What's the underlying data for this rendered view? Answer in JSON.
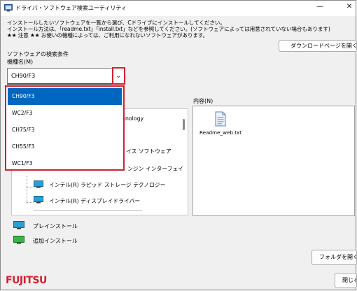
{
  "window": {
    "title": "ドライバ・ソフトウェア検索ユーティリティ",
    "minimize": "—",
    "close": "✕"
  },
  "intro": {
    "line1": "インストールしたいソフトウェアを一覧から選び、Cドライブにインストールしてください。",
    "line2": "インストール方法は、「readme.txt」「install.txt」などを参照してください。(ソフトウェアによっては用意されていない場合もあります)",
    "line3": "★★ 注意 ★★ お使いの機種によっては、ご利用になれないソフトウェアがあります。"
  },
  "download_button": "ダウンロードページを開く",
  "search": {
    "heading": "ソフトウェアの検索条件",
    "model_label": "機種名(M)",
    "selected": "CH90/F3",
    "chevron": "⌄",
    "options": [
      "CH90/F3",
      "WC2/F3",
      "CH75/F3",
      "CH55/F3",
      "WC1/F3"
    ]
  },
  "tree": {
    "partial_items": [
      "hnology",
      "イス ソフトウェア",
      "ンジン インターフェイ"
    ],
    "items": [
      "インテル(R) ラピッド ストレージ テクノロジー",
      "インテル(R) ディスプレイドライバー"
    ]
  },
  "content": {
    "label": "内容(N)",
    "file": "Readme_web.txt"
  },
  "legend": {
    "preinstall": "プレインストール",
    "additional": "追加インストール"
  },
  "open_folder_button": "フォルダを開く",
  "close_button": "閉じる",
  "logo": "FUJITSU",
  "colors": {
    "accent": "#0067c0",
    "highlight": "#d3202f",
    "logo": "#d3202f"
  }
}
